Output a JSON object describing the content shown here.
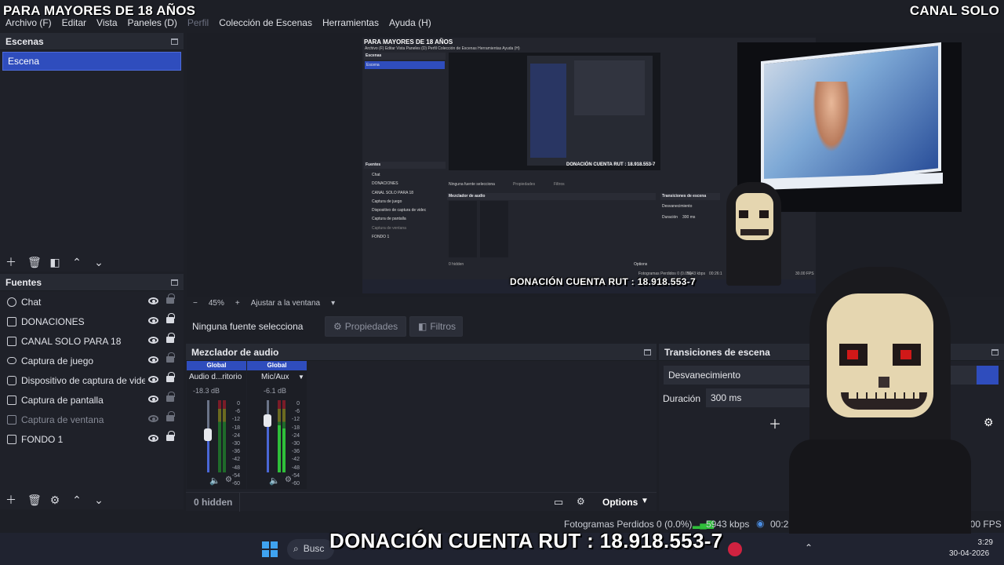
{
  "overlay": {
    "left_title": "PARA MAYORES DE 18 AÑOS",
    "right_title": "CANAL SOLO"
  },
  "menu": {
    "items": [
      "Archivo (F)",
      "Editar",
      "Vista",
      "Paneles (D)",
      "Perfil",
      "Colección de Escenas",
      "Herramientas",
      "Ayuda (H)"
    ]
  },
  "scenes": {
    "title": "Escenas",
    "items": [
      "Escena"
    ]
  },
  "sources": {
    "title": "Fuentes",
    "items": [
      {
        "label": "Chat",
        "icon": "globe-icon",
        "visible": true,
        "locked": false
      },
      {
        "label": "DONACIONES",
        "icon": "image-icon",
        "visible": true,
        "locked": true
      },
      {
        "label": "CANAL SOLO PARA 18",
        "icon": "image-icon",
        "visible": true,
        "locked": true
      },
      {
        "label": "Captura de juego",
        "icon": "gamepad-icon",
        "visible": true,
        "locked": false
      },
      {
        "label": "Dispositivo de captura de videc",
        "icon": "camera-icon",
        "visible": true,
        "locked": true
      },
      {
        "label": "Captura de pantalla",
        "icon": "monitor-icon",
        "visible": true,
        "locked": false
      },
      {
        "label": "Captura de ventana",
        "icon": "window-icon",
        "visible": false,
        "locked": false
      },
      {
        "label": "FONDO 1",
        "icon": "image-icon",
        "visible": true,
        "locked": true
      }
    ]
  },
  "preview_bar": {
    "zoom": "45%",
    "fit_label": "Ajustar a la ventana"
  },
  "properties_bar": {
    "no_source": "Ninguna fuente selecciona",
    "properties_btn": "Propiedades",
    "filters_btn": "Filtros"
  },
  "mixer": {
    "title": "Mezclador de audio",
    "strips": [
      {
        "head": "Global",
        "name": "Audio d...ritorio",
        "db": "-18.3 dB",
        "level": 0.0
      },
      {
        "head": "Global",
        "name": "Mic/Aux",
        "db": "-6.1 dB",
        "level": 0.55
      }
    ],
    "scale": [
      "0",
      "-6",
      "-12",
      "-18",
      "-24",
      "-30",
      "-36",
      "-42",
      "-48",
      "-54",
      "-60"
    ],
    "hidden": "0 hidden",
    "options": "Options"
  },
  "transitions": {
    "title": "Transiciones de escena",
    "selected": "Desvanecimiento",
    "duration_label": "Duración",
    "duration_value": "300 ms"
  },
  "status": {
    "dropped": "Fotogramas Perdidos 0 (0.0%)",
    "kbps": "5943 kbps",
    "time": "00:26:1",
    "fps": "30.00 FPS"
  },
  "taskbar": {
    "search": "Busc",
    "time": "3:29",
    "date": "30-04-2026"
  },
  "banner": {
    "donation_main": "DONACIÓN CUENTA RUT : 18.918.553-7",
    "donation_inner": "DONACIÓN CUENTA RUT : 18.918.553-7"
  },
  "nested": {
    "title": "PARA MAYORES DE 18 AÑOS",
    "menu": "Archivo (F)  Editar  Vista  Paneles (D)  Perfil  Colección de Escenas  Herramientas  Ayuda (H)",
    "scenes": "Escenas",
    "scene_item": "Escena",
    "sources": "Fuentes",
    "src": [
      "Chat",
      "DONACIONES",
      "CANAL SOLO PARA 18",
      "Captura de juego",
      "Dispositivo de captura de videc",
      "Captura de pantalla",
      "Captura de ventana",
      "FONDO 1"
    ],
    "no_source": "Ninguna fuente selecciona",
    "props": "Propiedades",
    "filters": "Filtros",
    "mixer": "Mezclador de audio",
    "trans": "Transiciones de escena",
    "desv": "Desvanecimiento",
    "dur": "Duración",
    "dur_val": "300 ms",
    "hidden": "0 hidden",
    "options": "Options",
    "status": "Fotogramas Perdidos 0 (0.0%)",
    "kbps": "5943 kbps",
    "time": "00:26:1",
    "fps": "30.00 FPS",
    "donation_small": "DONACIÓN CUENTA RUT : 18.918.553-7"
  },
  "colors": {
    "accent": "#2f4dbd",
    "panel": "#1f2129",
    "header": "#272a33",
    "meter_green": "#2fbf3a",
    "meter_red": "#c6283a"
  }
}
